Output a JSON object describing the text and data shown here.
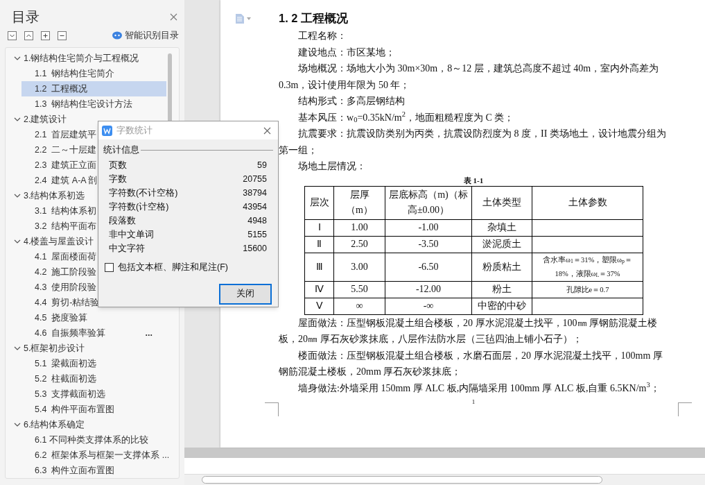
{
  "sidebar": {
    "title": "目录",
    "smart_button": "智能识别目录",
    "tree": [
      {
        "label": "1.钢结构住宅简介与工程概况",
        "expanded": true,
        "children": [
          {
            "label": "1.1  钢结构住宅简介",
            "selected": false
          },
          {
            "label": "1.2  工程概况",
            "selected": true
          },
          {
            "label": "1.3  钢结构住宅设计方法",
            "selected": false
          }
        ]
      },
      {
        "label": "2.建筑设计",
        "expanded": true,
        "children": [
          {
            "label": "2.1  首层建筑平",
            "selected": false
          },
          {
            "label": "2.2  二～十层建",
            "selected": false
          },
          {
            "label": "2.3  建筑正立面",
            "selected": false
          },
          {
            "label": "2.4  建筑 A-A 剖",
            "selected": false
          }
        ]
      },
      {
        "label": "3.结构体系初选",
        "expanded": true,
        "children": [
          {
            "label": "3.1  结构体系初",
            "selected": false
          },
          {
            "label": "3.2  结构平面布",
            "selected": false
          }
        ]
      },
      {
        "label": "4.楼盖与屋盖设计",
        "expanded": true,
        "children": [
          {
            "label": "4.1  屋面楼面荷",
            "selected": false
          },
          {
            "label": "4.2  施工阶段验",
            "selected": false
          },
          {
            "label": "4.3  使用阶段验",
            "selected": false
          },
          {
            "label": "4.4  剪切-粘结验",
            "selected": false
          },
          {
            "label": "4.5  挠度验算",
            "selected": false
          },
          {
            "label": "4.6  自振频率验算",
            "selected": false,
            "more": "..."
          }
        ]
      },
      {
        "label": "5.框架初步设计",
        "expanded": true,
        "children": [
          {
            "label": "5.1  梁截面初选",
            "selected": false
          },
          {
            "label": "5.2  柱截面初选",
            "selected": false
          },
          {
            "label": "5.3  支撑截面初选",
            "selected": false
          },
          {
            "label": "5.4  构件平面布置图",
            "selected": false
          }
        ]
      },
      {
        "label": "6.结构体系确定",
        "expanded": true,
        "children": [
          {
            "label": "6.1 不同种类支撑体系的比较",
            "selected": false
          },
          {
            "label": "6.2  框架体系与框架一支撑体系 ...",
            "selected": false
          },
          {
            "label": "6.3  构件立面布置图",
            "selected": false
          }
        ]
      }
    ]
  },
  "document": {
    "heading": "1. 2  工程概况",
    "paragraphs": [
      "工程名称：",
      "建设地点：市区某地；",
      "场地概况：场地大小为 30m×30m，8～12 层，建筑总高度不超过 40m，室内外高差为 0.3m，设计使用年限为 50 年；",
      "结构形式：多高层钢结构",
      "基本风压：w$_{0}$=0.35kN/m$^{2}$，地面粗糙程度为 C 类；",
      "抗震要求：抗震设防类别为丙类，抗震设防烈度为 8 度，II 类场地土，设计地震分组为第一组；",
      "场地土层情况："
    ],
    "table_caption": "表 1-1",
    "table": {
      "columns": [
        "层次",
        "层厚（m）",
        "层底标高（m)（标高±0.00）",
        "土体类型",
        "土体参数"
      ],
      "rows": [
        [
          "Ⅰ",
          "1.00",
          "-1.00",
          "杂填土",
          ""
        ],
        [
          "Ⅱ",
          "2.50",
          "-3.50",
          "淤泥质土",
          ""
        ],
        [
          "Ⅲ",
          "3.00",
          "-6.50",
          "粉质粘土",
          "含水率ω$_{1}$＝31%，塑限ω$_{p}$＝18%，液限ω$_{L}$＝37%"
        ],
        [
          "Ⅳ",
          "5.50",
          "-12.00",
          "粉土",
          "孔隙比e＝0.7"
        ],
        [
          "Ⅴ",
          "∞",
          "-∞",
          "中密的中砂",
          ""
        ]
      ]
    },
    "paragraphs_after": [
      "屋面做法：压型钢板混凝土组合楼板，20 厚水泥混凝土找平，100㎜ 厚钢筋混凝土楼板，20㎜ 厚石灰砂浆抹底，八层作法防水层（三毡四油上铺小石子）；",
      "楼面做法：压型钢板混凝土组合楼板，水磨石面层，20 厚水泥混凝土找平，100mm 厚钢筋混凝土楼板，20mm 厚石灰砂浆抹底；",
      "墙身做法:外墙采用 150mm 厚 ALC 板,内隔墙采用 100mm 厚 ALC 板,自重 6.5KN/m$^{3}$；"
    ],
    "page_number": "1"
  },
  "dialog": {
    "title": "字数统计",
    "group": "统计信息",
    "stats": [
      {
        "label": "页数",
        "value": "59"
      },
      {
        "label": "字数",
        "value": "20755"
      },
      {
        "label": "字符数(不计空格)",
        "value": "38794"
      },
      {
        "label": "字符数(计空格)",
        "value": "43954"
      },
      {
        "label": "段落数",
        "value": "4948"
      },
      {
        "label": "非中文单词",
        "value": "5155"
      },
      {
        "label": "中文字符",
        "value": "15600"
      }
    ],
    "checkbox": {
      "label": "包括文本框、脚注和尾注(F)",
      "checked": false
    },
    "button": "关闭"
  }
}
